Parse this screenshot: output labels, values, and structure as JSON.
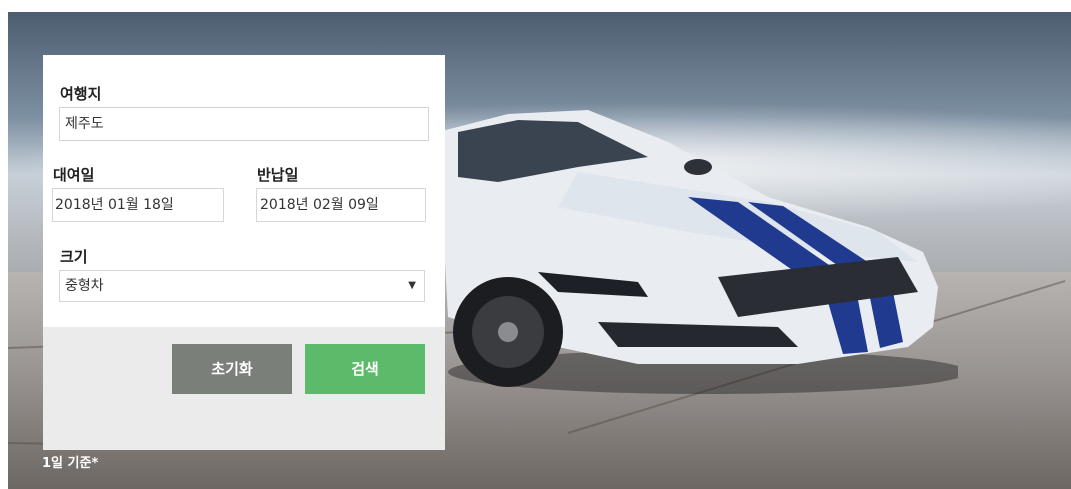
{
  "form": {
    "destination_label": "여행지",
    "destination_value": "제주도",
    "rental_date_label": "대여일",
    "rental_date_value": "2018년 01월 18일",
    "return_date_label": "반납일",
    "return_date_value": "2018년 02월 09일",
    "size_label": "크기",
    "size_selected": "중형차",
    "size_arrow": "▼"
  },
  "buttons": {
    "reset_label": "초기화",
    "search_label": "검색"
  },
  "note": "1일 기준*",
  "colors": {
    "reset_button": "#7a7f7a",
    "search_button": "#5cba6b"
  }
}
